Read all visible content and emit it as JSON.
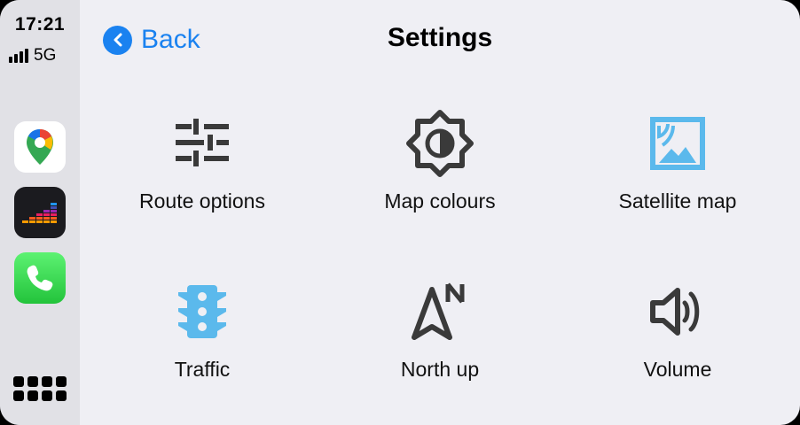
{
  "status": {
    "time": "17:21",
    "network": "5G"
  },
  "sidebar": {
    "apps": [
      {
        "name": "Google Maps",
        "icon": "google-maps-icon"
      },
      {
        "name": "Deezer",
        "icon": "deezer-icon"
      },
      {
        "name": "Phone",
        "icon": "phone-icon"
      }
    ],
    "launcher_icon": "app-grid-icon"
  },
  "header": {
    "back_label": "Back",
    "title": "Settings"
  },
  "settings": [
    {
      "label": "Route options",
      "icon": "sliders-icon"
    },
    {
      "label": "Map colours",
      "icon": "brightness-icon"
    },
    {
      "label": "Satellite map",
      "icon": "satellite-image-icon"
    },
    {
      "label": "Traffic",
      "icon": "traffic-light-icon"
    },
    {
      "label": "North up",
      "icon": "north-arrow-icon"
    },
    {
      "label": "Volume",
      "icon": "speaker-icon"
    }
  ],
  "colors": {
    "accent": "#1a82f0",
    "icon_dark": "#3a3a3a",
    "icon_blue": "#5bb9ec"
  }
}
